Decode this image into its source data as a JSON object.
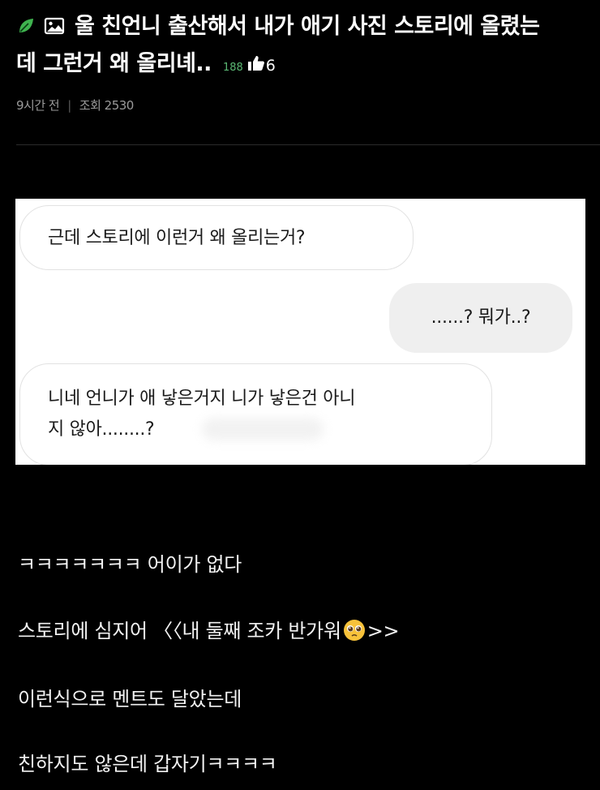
{
  "post": {
    "title_line1": "울 친언니 출산해서 내가 애기 사진 스토리에 올렸는",
    "title_line2": "데 그런거 왜 올리녜..",
    "reply_count": "188",
    "like_count": "6",
    "time": "9시간 전",
    "views": "조회 2530",
    "icons": {
      "category": "leaf-icon",
      "attachment": "image-icon",
      "like": "thumbs-up-icon"
    },
    "colors": {
      "accent_green": "#5bb974",
      "background": "#000000"
    }
  },
  "chat": {
    "message1": "근데 스토리에 이런거 왜 올리는거?",
    "message2": "......? 뭐가..?",
    "message3_line1": "니네 언니가 애 낳은거지 니가 낳은건 아니",
    "message3_line2": "지 않아........?"
  },
  "body": {
    "line1": "ㅋㅋㅋㅋㅋㅋㅋ 어이가 없다",
    "line2_prefix": "스토리에 심지어 〈〈내 둘째 조카 반가워",
    "line2_suffix": ">>",
    "line2_emoji": "pleading-face-emoji",
    "line3": "이런식으로 멘트도 달았는데",
    "line4": "친하지도 않은데 갑자기ㅋㅋㅋㅋ"
  }
}
